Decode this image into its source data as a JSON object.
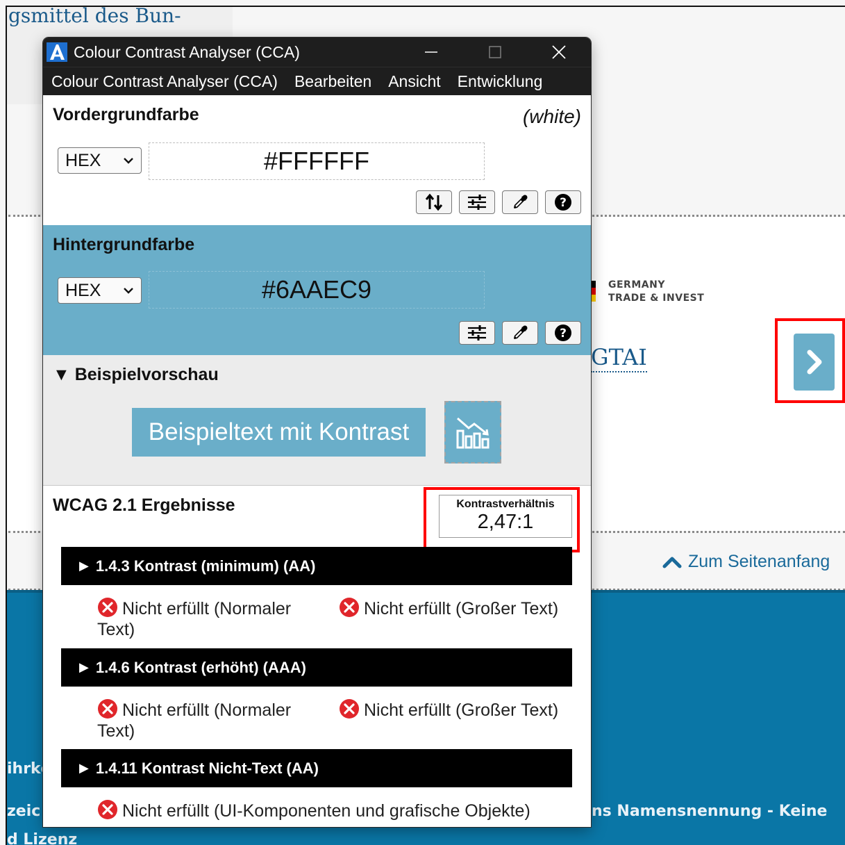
{
  "background_page": {
    "heading_fragment": "gsmittel des Bun-",
    "logo_text_line1": "GERMANY",
    "logo_text_line2": "TRADE & INVEST",
    "gtai_link": "GTAI",
    "scroll_top_label": "Zum Seitenanfang",
    "footer_fragment_1": "ihrkc",
    "footer_fragment_2": "zeic",
    "footer_fragment_3": "d Lizenz",
    "footer_fragment_4": "ns Namensnennung - Keine",
    "accent_color": "#6aaec9",
    "footer_color": "#0a76a6"
  },
  "window": {
    "title": "Colour Contrast Analyser (CCA)",
    "controls": [
      "minimize",
      "maximize",
      "close"
    ]
  },
  "menu": [
    "Colour Contrast Analyser (CCA)",
    "Bearbeiten",
    "Ansicht",
    "Entwicklung"
  ],
  "foreground": {
    "title": "Vordergrundfarbe",
    "color_name": "(white)",
    "format": "HEX",
    "hex_value": "#FFFFFF",
    "color": "#FFFFFF",
    "tools": [
      "swap-icon",
      "sliders-icon",
      "eyedropper-icon",
      "help-icon"
    ]
  },
  "background": {
    "title": "Hintergrundfarbe",
    "format": "HEX",
    "hex_value": "#6AAEC9",
    "color": "#6AAEC9",
    "tools": [
      "sliders-icon",
      "eyedropper-icon",
      "help-icon"
    ]
  },
  "preview": {
    "title": "▼ Beispielvorschau",
    "sample_text": "Beispieltext mit Kontrast",
    "sample_icon": "chart-icon"
  },
  "results": {
    "title": "WCAG 2.1 Ergebnisse",
    "ratio_label": "Kontrastverhältnis",
    "ratio_value": "2,47:1",
    "criteria": [
      {
        "header": "1.4.3 Kontrast (minimum) (AA)",
        "items": [
          "Nicht erfüllt (Normaler Text)",
          "Nicht erfüllt (Großer Text)"
        ]
      },
      {
        "header": "1.4.6 Kontrast (erhöht) (AAA)",
        "items": [
          "Nicht erfüllt (Normaler Text)",
          "Nicht erfüllt (Großer Text)"
        ]
      },
      {
        "header": "1.4.11 Kontrast Nicht-Text (AA)",
        "items": [
          "Nicht erfüllt (UI-Komponenten und grafische Objekte)"
        ]
      }
    ]
  }
}
